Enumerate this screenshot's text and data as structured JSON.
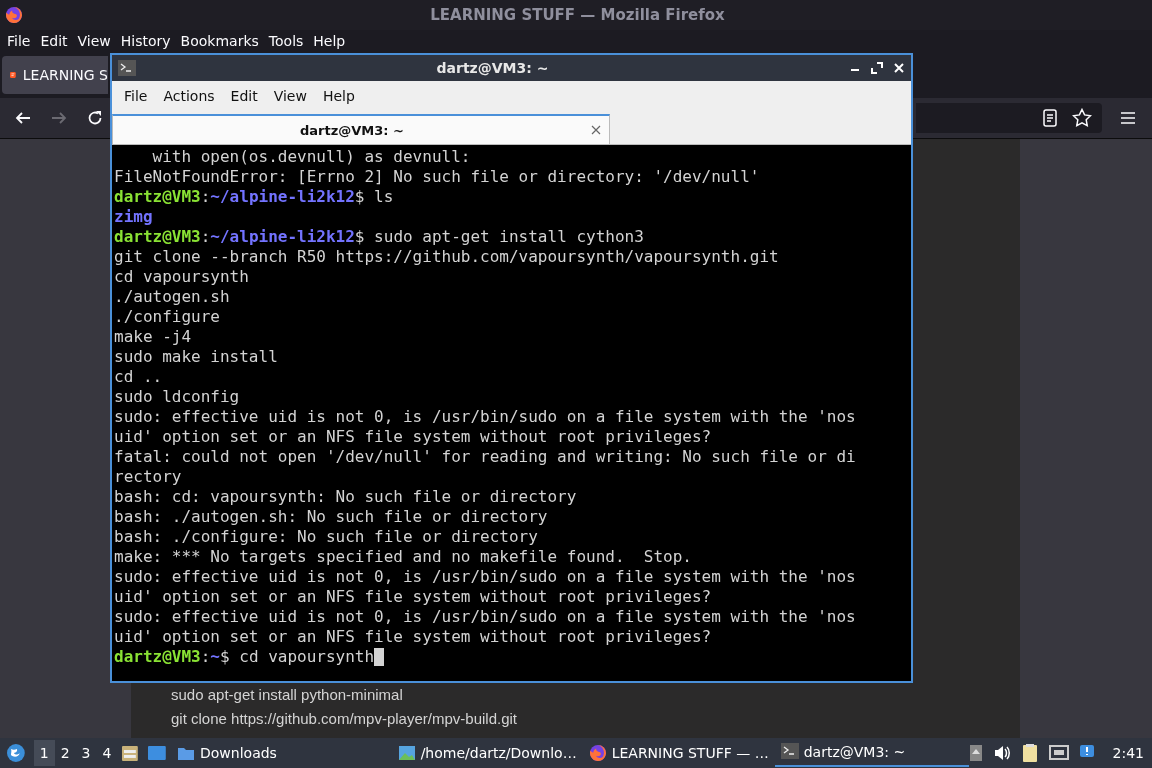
{
  "firefox": {
    "title": "LEARNING STUFF — Mozilla Firefox",
    "menu": [
      "File",
      "Edit",
      "View",
      "History",
      "Bookmarks",
      "Tools",
      "Help"
    ],
    "tab": {
      "label": "LEARNING S"
    },
    "nav": [
      {
        "kind": "back",
        "disabled": false
      },
      {
        "kind": "forward",
        "disabled": true
      },
      {
        "kind": "reload",
        "disabled": false
      }
    ],
    "page_lines": [
      "sudo apt-get install python-minimal",
      "git clone https://github.com/mpv-player/mpv-build.git"
    ]
  },
  "terminal": {
    "title": "dartz@VM3: ~",
    "menu": [
      "File",
      "Actions",
      "Edit",
      "View",
      "Help"
    ],
    "tab": {
      "label": "dartz@VM3: ~",
      "selected": true
    },
    "lines": [
      {
        "kind": "output",
        "text": "    with open(os.devnull) as devnull:"
      },
      {
        "kind": "output",
        "text": "FileNotFoundError: [Errno 2] No such file or directory: '/dev/null'"
      },
      {
        "kind": "prompt",
        "user": "dartz@VM3",
        "separator": ":",
        "path": "~/alpine-li2k12",
        "command": "$ ls"
      },
      {
        "kind": "dir",
        "text": "zimg"
      },
      {
        "kind": "prompt",
        "user": "dartz@VM3",
        "separator": ":",
        "path": "~/alpine-li2k12",
        "command": "$ sudo apt-get install cython3"
      },
      {
        "kind": "output",
        "text": "git clone --branch R50 https://github.com/vapoursynth/vapoursynth.git"
      },
      {
        "kind": "output",
        "text": "cd vapoursynth"
      },
      {
        "kind": "output",
        "text": "./autogen.sh"
      },
      {
        "kind": "output",
        "text": "./configure"
      },
      {
        "kind": "output",
        "text": "make -j4"
      },
      {
        "kind": "output",
        "text": "sudo make install"
      },
      {
        "kind": "output",
        "text": "cd .."
      },
      {
        "kind": "output",
        "text": "sudo ldconfig"
      },
      {
        "kind": "output",
        "text": "sudo: effective uid is not 0, is /usr/bin/sudo on a file system with the 'nos"
      },
      {
        "kind": "output",
        "text": "uid' option set or an NFS file system without root privileges?"
      },
      {
        "kind": "output",
        "text": "fatal: could not open '/dev/null' for reading and writing: No such file or di"
      },
      {
        "kind": "output",
        "text": "rectory"
      },
      {
        "kind": "output",
        "text": "bash: cd: vapoursynth: No such file or directory"
      },
      {
        "kind": "output",
        "text": "bash: ./autogen.sh: No such file or directory"
      },
      {
        "kind": "output",
        "text": "bash: ./configure: No such file or directory"
      },
      {
        "kind": "output",
        "text": "make: *** No targets specified and no makefile found.  Stop."
      },
      {
        "kind": "output",
        "text": "sudo: effective uid is not 0, is /usr/bin/sudo on a file system with the 'nos"
      },
      {
        "kind": "output",
        "text": "uid' option set or an NFS file system without root privileges?"
      },
      {
        "kind": "output",
        "text": "sudo: effective uid is not 0, is /usr/bin/sudo on a file system with the 'nos"
      },
      {
        "kind": "output",
        "text": "uid' option set or an NFS file system without root privileges?"
      },
      {
        "kind": "prompt",
        "user": "dartz@VM3",
        "separator": ":",
        "path": "~",
        "command": "$ cd vapoursynth",
        "cursor": true
      }
    ]
  },
  "taskbar": {
    "workspaces": [
      {
        "label": "1",
        "selected": true
      },
      {
        "label": "2",
        "selected": false
      },
      {
        "label": "3",
        "selected": false
      },
      {
        "label": "4",
        "selected": false
      }
    ],
    "tasks": [
      {
        "kind": "folder",
        "label": "Downloads",
        "selected": false
      },
      {
        "kind": "image",
        "label": "/home/dartz/Downlo…",
        "selected": false
      },
      {
        "kind": "firefox",
        "label": "LEARNING STUFF — …",
        "selected": false
      },
      {
        "kind": "terminal",
        "label": "dartz@VM3: ~",
        "selected": true
      }
    ],
    "clock": "2:41"
  }
}
